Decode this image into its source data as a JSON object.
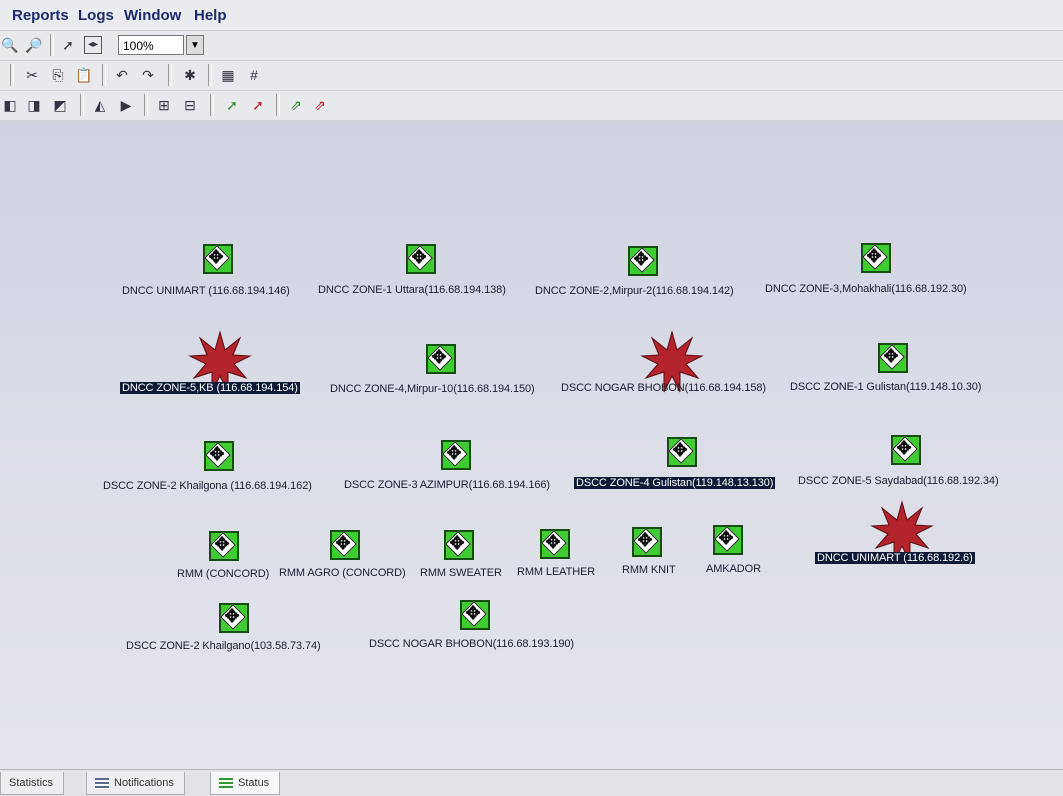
{
  "menu": [
    "Reports",
    "Logs",
    "Window",
    "Help"
  ],
  "toolbar": {
    "zoom_value": "100%"
  },
  "nodes": [
    {
      "label": "DNCC UNIMART (116.68.194.146)",
      "status": "up"
    },
    {
      "label": "DNCC ZONE-1 Uttara(116.68.194.138)",
      "status": "up"
    },
    {
      "label": "DNCC ZONE-2,Mirpur-2(116.68.194.142)",
      "status": "up"
    },
    {
      "label": "DNCC ZONE-3,Mohakhali(116.68.192.30)",
      "status": "up"
    },
    {
      "label": "DNCC ZONE-5,KB (116.68.194.154)",
      "status": "down",
      "selected": true
    },
    {
      "label": "DNCC ZONE-4,Mirpur-10(116.68.194.150)",
      "status": "up"
    },
    {
      "label": "DSCC NOGAR BHOBON(116.68.194.158)",
      "status": "down"
    },
    {
      "label": "DSCC ZONE-1 Gulistan(119.148.10.30)",
      "status": "up"
    },
    {
      "label": "DSCC ZONE-2 Khailgona (116.68.194.162)",
      "status": "up"
    },
    {
      "label": "DSCC ZONE-3 AZIMPUR(116.68.194.166)",
      "status": "up"
    },
    {
      "label": "DSCC ZONE-4 Gulistan(119.148.13.130)",
      "status": "up",
      "selected": true
    },
    {
      "label": "DSCC ZONE-5 Saydabad(116.68.192.34)",
      "status": "up"
    },
    {
      "label": "RMM (CONCORD)",
      "status": "up"
    },
    {
      "label": "RMM AGRO (CONCORD)",
      "status": "up"
    },
    {
      "label": "RMM SWEATER",
      "status": "up"
    },
    {
      "label": "RMM LEATHER",
      "status": "up"
    },
    {
      "label": "RMM KNIT",
      "status": "up"
    },
    {
      "label": "AMKADOR",
      "status": "up"
    },
    {
      "label": "DNCC UNIMART (116.68.192.6)",
      "status": "down",
      "selected": true
    },
    {
      "label": "DSCC ZONE-2 Khailgano(103.58.73.74)",
      "status": "up"
    },
    {
      "label": "DSCC NOGAR BHOBON(116.68.193.190)",
      "status": "up"
    }
  ],
  "status_tabs": [
    "Statistics",
    "Notifications",
    "Status"
  ],
  "colors": {
    "node_up": "#3fcc33",
    "node_down": "#b3242c",
    "selection": "#0e1a36"
  }
}
